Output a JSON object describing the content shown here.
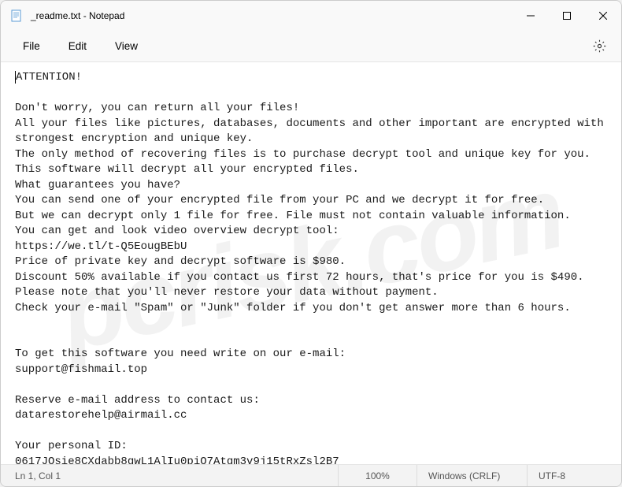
{
  "titlebar": {
    "title": "_readme.txt - Notepad"
  },
  "menu": {
    "file": "File",
    "edit": "Edit",
    "view": "View"
  },
  "body": {
    "line1": "ATTENTION!",
    "line2": "",
    "line3": "Don't worry, you can return all your files!",
    "line4": "All your files like pictures, databases, documents and other important are encrypted with strongest encryption and unique key.",
    "line5": "The only method of recovering files is to purchase decrypt tool and unique key for you.",
    "line6": "This software will decrypt all your encrypted files.",
    "line7": "What guarantees you have?",
    "line8": "You can send one of your encrypted file from your PC and we decrypt it for free.",
    "line9": "But we can decrypt only 1 file for free. File must not contain valuable information.",
    "line10": "You can get and look video overview decrypt tool:",
    "line11": "https://we.tl/t-Q5EougBEbU",
    "line12": "Price of private key and decrypt software is $980.",
    "line13": "Discount 50% available if you contact us first 72 hours, that's price for you is $490.",
    "line14": "Please note that you'll never restore your data without payment.",
    "line15": "Check your e-mail \"Spam\" or \"Junk\" folder if you don't get answer more than 6 hours.",
    "line16": "",
    "line17": "",
    "line18": "To get this software you need write on our e-mail:",
    "line19": "support@fishmail.top",
    "line20": "",
    "line21": "Reserve e-mail address to contact us:",
    "line22": "datarestorehelp@airmail.cc",
    "line23": "",
    "line24": "Your personal ID:",
    "line25": "0617JOsie8CXdabb8gwL1AlIu0piO7Atgm3v9j15tRxZsl2B7"
  },
  "status": {
    "position": "Ln 1, Col 1",
    "zoom": "100%",
    "eol": "Windows (CRLF)",
    "encoding": "UTF-8"
  },
  "watermark": "pcrisk.com"
}
